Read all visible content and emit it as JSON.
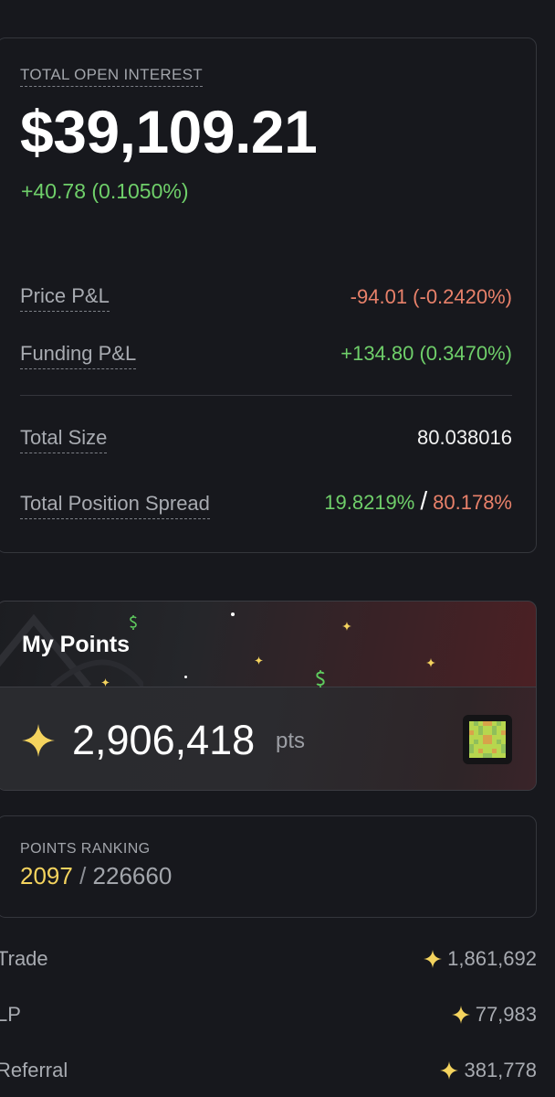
{
  "open_interest": {
    "label": "TOTAL OPEN INTEREST",
    "value": "$39,109.21",
    "change": "+40.78 (0.1050%)",
    "price_pnl": {
      "label": "Price P&L",
      "value": "-94.01 (-0.2420%)"
    },
    "funding_pnl": {
      "label": "Funding P&L",
      "value": "+134.80 (0.3470%)"
    },
    "total_size": {
      "label": "Total Size",
      "value": "80.038016"
    },
    "position_spread": {
      "label": "Total Position Spread",
      "long": "19.8219%",
      "separator": "/",
      "short": "80.178%"
    }
  },
  "my_points": {
    "title": "My Points",
    "value": "2,906,418",
    "unit": "pts"
  },
  "ranking": {
    "label": "POINTS RANKING",
    "position": "2097",
    "separator": "/",
    "total": "226660"
  },
  "breakdown": [
    {
      "label": "Trade",
      "value": "1,861,692"
    },
    {
      "label": "LP",
      "value": "77,983"
    },
    {
      "label": "Referral",
      "value": "381,778"
    }
  ],
  "colors": {
    "background": "#17181d",
    "positive": "#6fcf6a",
    "negative": "#e8816a",
    "star": "#f4d35e",
    "card_border": "#34363c"
  },
  "icons": [
    "sparkle-icon",
    "dollar-icon",
    "pixel-avatar-icon"
  ]
}
